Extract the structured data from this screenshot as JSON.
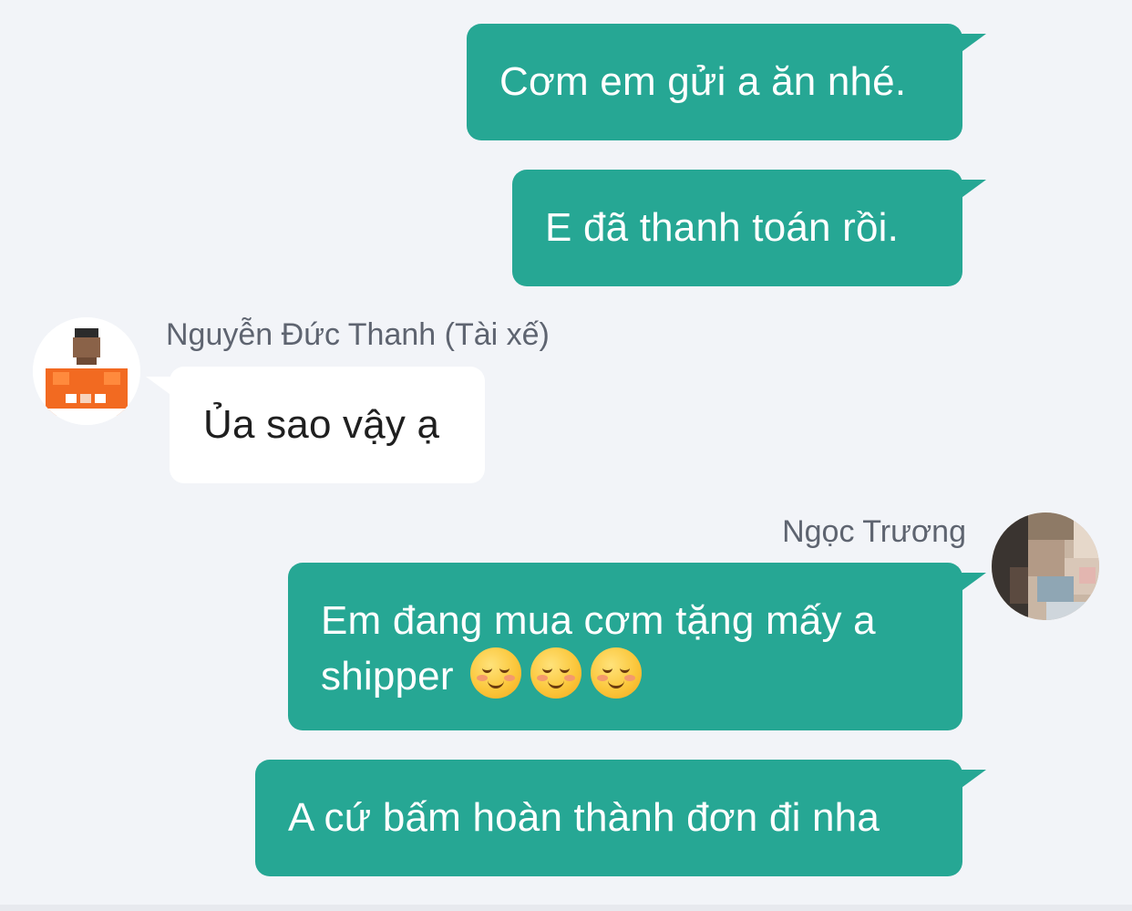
{
  "messages": [
    {
      "id": "m1",
      "direction": "outgoing",
      "text": "Cơm em gửi a ăn nhé."
    },
    {
      "id": "m2",
      "direction": "outgoing",
      "text": "E đã thanh toán rồi."
    },
    {
      "id": "m3",
      "direction": "incoming",
      "sender": "Nguyễn Đức Thanh (Tài xế)",
      "text": "Ủa sao vậy ạ"
    },
    {
      "id": "m4",
      "direction": "outgoing",
      "sender": "Ngọc Trương",
      "text_line1": "Em đang mua cơm tặng mấy a",
      "text_line2": "shipper",
      "emoji_count": 3,
      "emoji": "smiling-face-emoji"
    },
    {
      "id": "m5",
      "direction": "outgoing",
      "text": "A cứ bấm hoàn thành đơn đi nha"
    }
  ],
  "colors": {
    "background": "#f2f4f8",
    "outgoing_bubble": "#26a794",
    "incoming_bubble": "#ffffff",
    "sender_name": "#5e6470"
  }
}
